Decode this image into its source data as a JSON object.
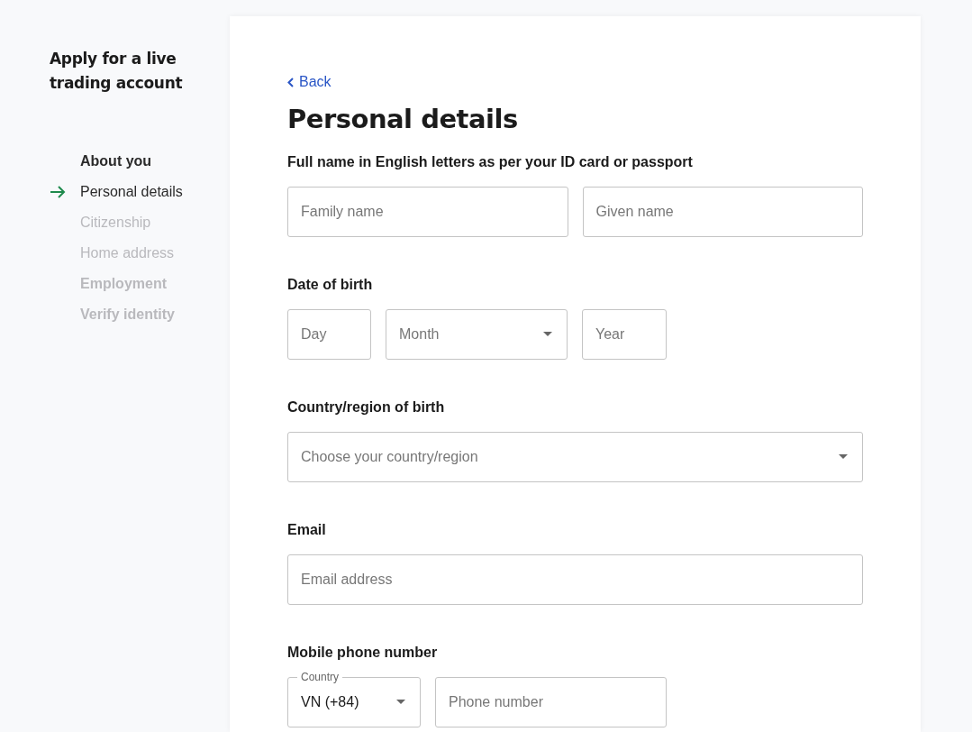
{
  "sidebar": {
    "title": "Apply for a live trading account",
    "steps": [
      {
        "label": "About you",
        "kind": "section",
        "enabled": true,
        "selected": false
      },
      {
        "label": "Personal details",
        "kind": "step",
        "enabled": true,
        "selected": true
      },
      {
        "label": "Citizenship",
        "kind": "step",
        "enabled": false,
        "selected": false
      },
      {
        "label": "Home address",
        "kind": "step",
        "enabled": false,
        "selected": false
      },
      {
        "label": "Employment",
        "kind": "section",
        "enabled": false,
        "selected": false
      },
      {
        "label": "Verify identity",
        "kind": "section",
        "enabled": false,
        "selected": false
      }
    ]
  },
  "form": {
    "back": "Back",
    "title": "Personal details",
    "sections": [
      {
        "label": "Full name in English letters as per your ID card or passport",
        "kind": "pair",
        "fields": [
          {
            "kind": "text",
            "placeholder": "Family name"
          },
          {
            "kind": "text",
            "placeholder": "Given name"
          }
        ]
      },
      {
        "label": "Date of birth",
        "kind": "date",
        "fields": [
          {
            "kind": "text",
            "placeholder": "Day"
          },
          {
            "kind": "select",
            "placeholder": "Month"
          },
          {
            "kind": "text",
            "placeholder": "Year"
          }
        ]
      },
      {
        "label": "Country/region of birth",
        "kind": "full",
        "fields": [
          {
            "kind": "select",
            "placeholder": "Choose your country/region"
          }
        ]
      },
      {
        "label": "Email",
        "kind": "full",
        "fields": [
          {
            "kind": "text",
            "placeholder": "Email address"
          }
        ]
      },
      {
        "label": "Mobile phone number",
        "kind": "phone",
        "fields": [
          {
            "kind": "select",
            "label": "Country",
            "value": "VN (+84)"
          },
          {
            "kind": "text",
            "placeholder": "Phone number"
          }
        ]
      }
    ]
  }
}
